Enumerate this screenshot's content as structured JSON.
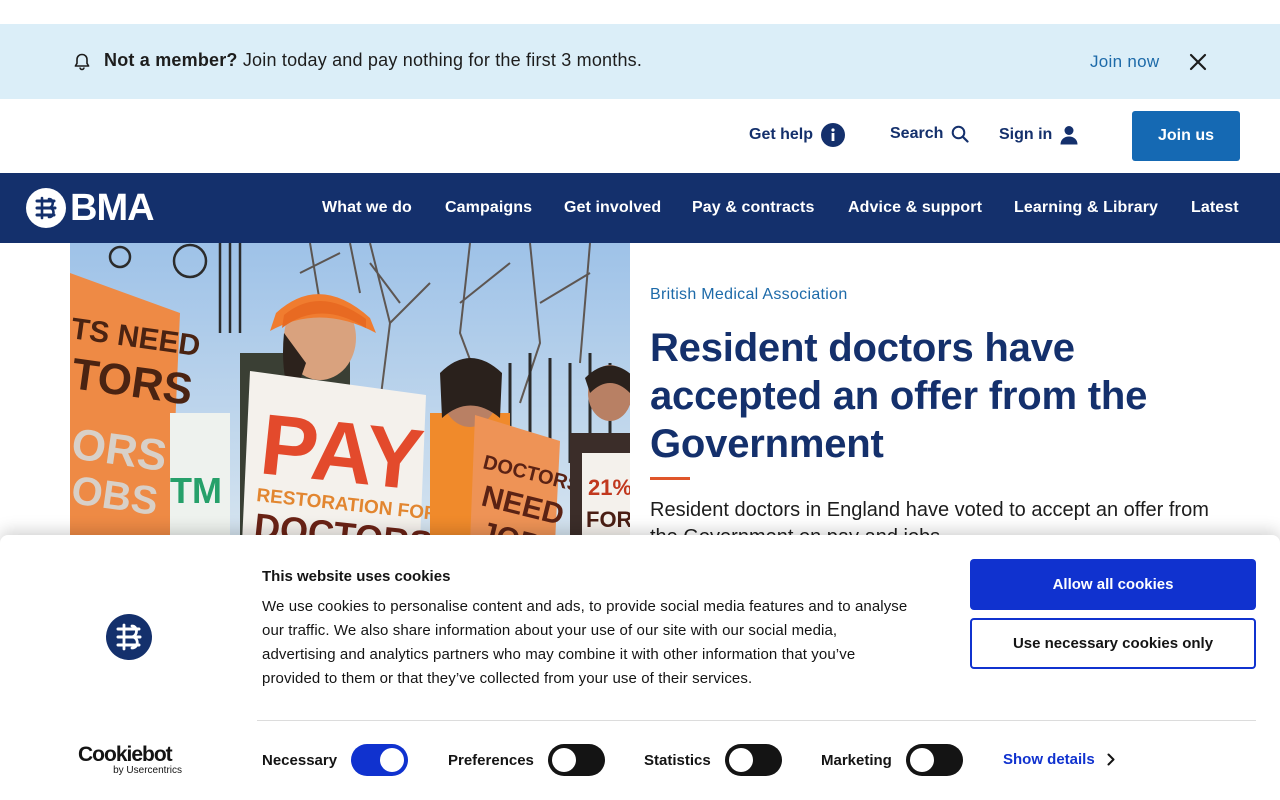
{
  "member_banner": {
    "bold": "Not a member?",
    "message": "Join today and pay nothing for the first 3 months.",
    "join_link": "Join now"
  },
  "utility_bar": {
    "get_help": "Get help",
    "search": "Search",
    "sign_in": "Sign in",
    "join_us": "Join us"
  },
  "nav": {
    "logo_text": "BMA",
    "items": [
      "What we do",
      "Campaigns",
      "Get involved",
      "Pay & contracts",
      "Advice & support",
      "Learning & Library",
      "Latest"
    ]
  },
  "hero": {
    "kicker": "British Medical Association",
    "headline": "Resident doctors have accepted an offer from the Government",
    "summary": "Resident doctors in England have voted to accept an offer from the Government on pay and jobs."
  },
  "cookie_dialog": {
    "title": "This website uses cookies",
    "body": "We use cookies to personalise content and ads, to provide social media features and to analyse our traffic. We also share information about your use of our site with our social media, advertising and analytics partners who may combine it with other information that you’ve provided to them or that they’ve collected from your use of their services.",
    "allow_all": "Allow all cookies",
    "necessary_only": "Use necessary cookies only",
    "brand": "Cookiebot",
    "brand_by": "by Usercentrics",
    "toggles": [
      {
        "label": "Necessary",
        "state": "on"
      },
      {
        "label": "Preferences",
        "state": "off"
      },
      {
        "label": "Statistics",
        "state": "off"
      },
      {
        "label": "Marketing",
        "state": "off"
      }
    ],
    "show_details": "Show details"
  },
  "colors": {
    "navy": "#14306c",
    "link_blue": "#1d6aa9",
    "banner_bg": "#dbeef8",
    "cookie_blue": "#1032cf",
    "accent_orange": "#e0562a"
  },
  "icons": [
    "bell-icon",
    "close-icon",
    "info-icon",
    "search-icon",
    "user-icon",
    "bma-logo-mark",
    "chevron-right-icon"
  ]
}
